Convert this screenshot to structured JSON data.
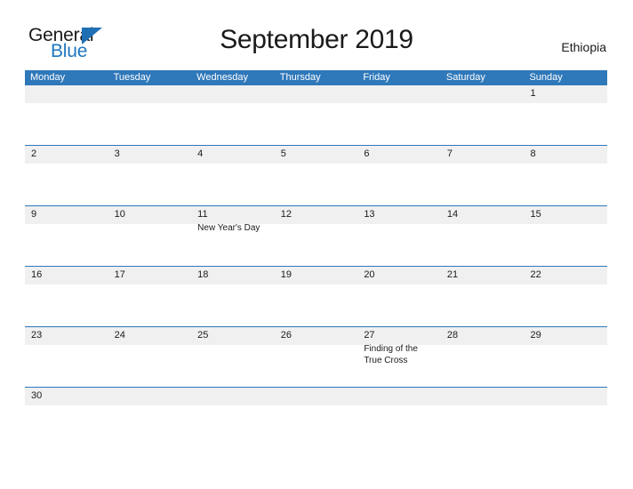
{
  "brand": {
    "name_part1": "General",
    "name_part2": "Blue",
    "triangle_color": "#1f6fb5",
    "blue_color": "#1f77bf"
  },
  "header": {
    "title": "September 2019",
    "region": "Ethiopia",
    "header_bg_color": "#2f78ba",
    "band_color": "#f0f0f0"
  },
  "weekdays": [
    "Monday",
    "Tuesday",
    "Wednesday",
    "Thursday",
    "Friday",
    "Saturday",
    "Sunday"
  ],
  "weeks": [
    {
      "days": [
        {
          "num": "",
          "events": []
        },
        {
          "num": "",
          "events": []
        },
        {
          "num": "",
          "events": []
        },
        {
          "num": "",
          "events": []
        },
        {
          "num": "",
          "events": []
        },
        {
          "num": "",
          "events": []
        },
        {
          "num": "1",
          "events": []
        }
      ]
    },
    {
      "days": [
        {
          "num": "2",
          "events": []
        },
        {
          "num": "3",
          "events": []
        },
        {
          "num": "4",
          "events": []
        },
        {
          "num": "5",
          "events": []
        },
        {
          "num": "6",
          "events": []
        },
        {
          "num": "7",
          "events": []
        },
        {
          "num": "8",
          "events": []
        }
      ]
    },
    {
      "days": [
        {
          "num": "9",
          "events": []
        },
        {
          "num": "10",
          "events": []
        },
        {
          "num": "11",
          "events": [
            "New Year's Day"
          ]
        },
        {
          "num": "12",
          "events": []
        },
        {
          "num": "13",
          "events": []
        },
        {
          "num": "14",
          "events": []
        },
        {
          "num": "15",
          "events": []
        }
      ]
    },
    {
      "days": [
        {
          "num": "16",
          "events": []
        },
        {
          "num": "17",
          "events": []
        },
        {
          "num": "18",
          "events": []
        },
        {
          "num": "19",
          "events": []
        },
        {
          "num": "20",
          "events": []
        },
        {
          "num": "21",
          "events": []
        },
        {
          "num": "22",
          "events": []
        }
      ]
    },
    {
      "days": [
        {
          "num": "23",
          "events": []
        },
        {
          "num": "24",
          "events": []
        },
        {
          "num": "25",
          "events": []
        },
        {
          "num": "26",
          "events": []
        },
        {
          "num": "27",
          "events": [
            "Finding of the True Cross"
          ]
        },
        {
          "num": "28",
          "events": []
        },
        {
          "num": "29",
          "events": []
        }
      ]
    },
    {
      "days": [
        {
          "num": "30",
          "events": []
        },
        {
          "num": "",
          "events": []
        },
        {
          "num": "",
          "events": []
        },
        {
          "num": "",
          "events": []
        },
        {
          "num": "",
          "events": []
        },
        {
          "num": "",
          "events": []
        },
        {
          "num": "",
          "events": []
        }
      ]
    }
  ]
}
